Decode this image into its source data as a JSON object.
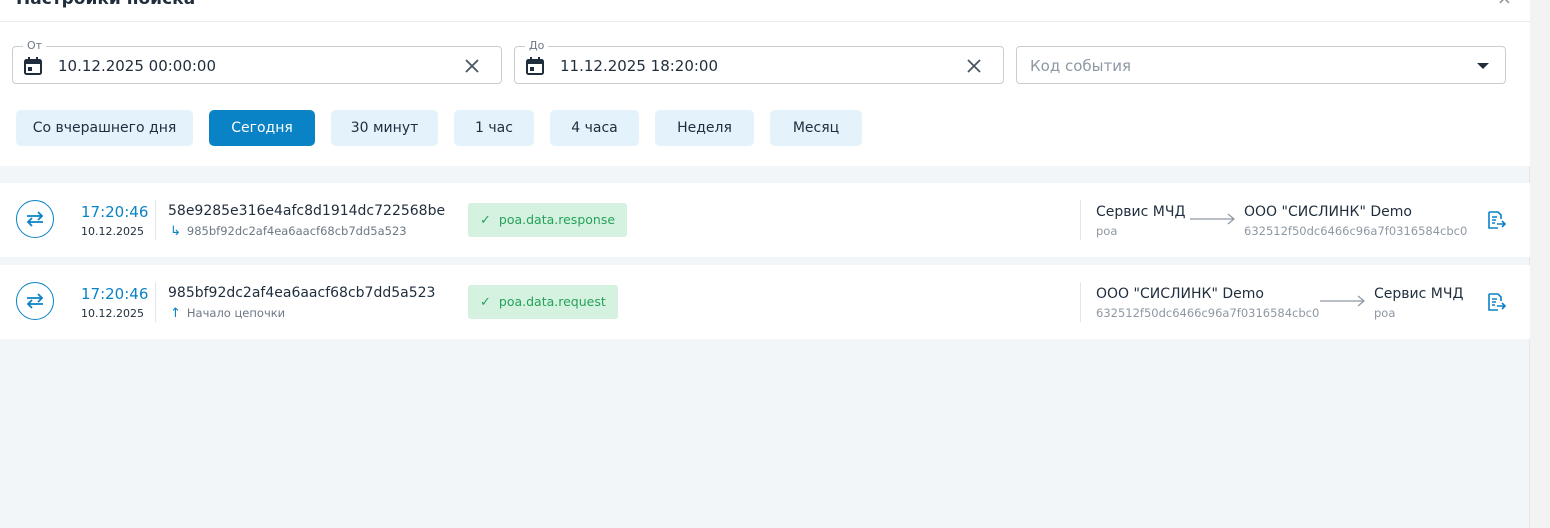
{
  "panel": {
    "title": "Настройки поиска",
    "close": "×"
  },
  "filters": {
    "from": {
      "legend": "От",
      "value": "10.12.2025 00:00:00"
    },
    "to": {
      "legend": "До",
      "value": "11.12.2025 18:20:00"
    },
    "event_code": {
      "placeholder": "Код события"
    }
  },
  "presets": [
    {
      "label": "Со вчерашнего дня",
      "active": false
    },
    {
      "label": "Сегодня",
      "active": true
    },
    {
      "label": "30 минут",
      "active": false
    },
    {
      "label": "1 час",
      "active": false
    },
    {
      "label": "4 часа",
      "active": false
    },
    {
      "label": "Неделя",
      "active": false
    },
    {
      "label": "Месяц",
      "active": false
    }
  ],
  "events": [
    {
      "time": "17:20:46",
      "date": "10.12.2025",
      "id": "58e9285e316e4afc8d1914dc722568be",
      "sub_icon": "↳",
      "sub": "985bf92dc2af4ea6aacf68cb7dd5a523",
      "badge": "poa.data.response",
      "from_name": "Сервис МЧД",
      "from_sub": "poa",
      "to_name": "ООО \"СИСЛИНК\" Demo",
      "to_sub": "632512f50dc6466c96a7f0316584cbc0"
    },
    {
      "time": "17:20:46",
      "date": "10.12.2025",
      "id": "985bf92dc2af4ea6aacf68cb7dd5a523",
      "sub_icon": "↑",
      "sub": "Начало цепочки",
      "badge": "poa.data.request",
      "from_name": "ООО \"СИСЛИНК\" Demo",
      "from_sub": "632512f50dc6466c96a7f0316584cbc0",
      "to_name": "Сервис МЧД",
      "to_sub": "poa"
    }
  ],
  "colors": {
    "accent": "#0a82c6",
    "preset_bg": "#e3f2fb",
    "badge_bg": "#d5f1df",
    "badge_text": "#25a35a"
  },
  "icons": {
    "calendar": "calendar-icon",
    "clear": "close-icon",
    "exchange": "exchange-arrows-icon",
    "document": "document-export-icon",
    "check": "check-icon"
  }
}
